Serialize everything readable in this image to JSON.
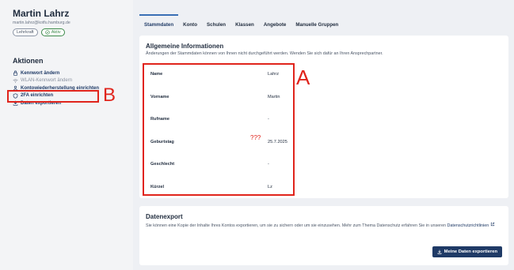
{
  "user": {
    "name": "Martin Lahrz",
    "email": "martin.lahrz@kotfu.hamburg.de",
    "role_badge": "Lehrkraft",
    "status_badge": "Aktiv"
  },
  "sidebar": {
    "actions_title": "Aktionen",
    "actions": [
      {
        "label": "Kennwort ändern",
        "icon": "lock-icon",
        "disabled": false
      },
      {
        "label": "WLAN-Kennwort ändern",
        "icon": "wifi-icon",
        "disabled": true
      },
      {
        "label": "Kontowiederherstellung einrichten",
        "icon": "user-icon",
        "disabled": false
      },
      {
        "label": "2FA einrichten",
        "icon": "shield-icon",
        "disabled": false
      },
      {
        "label": "Daten exportieren",
        "icon": "download-icon",
        "disabled": false
      }
    ]
  },
  "tabs": [
    "Stammdaten",
    "Konto",
    "Schulen",
    "Klassen",
    "Angebote",
    "Manuelle Gruppen"
  ],
  "general": {
    "title": "Allgemeine Informationen",
    "subtitle": "Änderungen der Stammdaten können von Ihnen nicht durchgeführt werden. Wenden Sie sich dafür an Ihren Ansprechpartner.",
    "rows": [
      {
        "key": "Name",
        "value": "Lahrz"
      },
      {
        "key": "Vorname",
        "value": "Martin"
      },
      {
        "key": "Rufname",
        "value": "-"
      },
      {
        "key": "Geburtstag",
        "value": "25.7.2025"
      },
      {
        "key": "Geschlecht",
        "value": "-"
      },
      {
        "key": "Kürzel",
        "value": "Lz"
      }
    ]
  },
  "export": {
    "title": "Datenexport",
    "text": "Sie können eine Kopie der Inhalte Ihres Kontos exportieren, um sie zu sichern oder um sie einzusehen. Mehr zum Thema Datenschutz erfahren Sie in unseren",
    "link": "Datenschutzrichtlinien",
    "button": "Meine Daten exportieren"
  },
  "annotations": {
    "label_a": "A",
    "label_b": "B",
    "question": "???"
  },
  "colors": {
    "accent": "#1f3a66",
    "annotation": "#e0241c",
    "active_badge": "#3c8a4a"
  }
}
